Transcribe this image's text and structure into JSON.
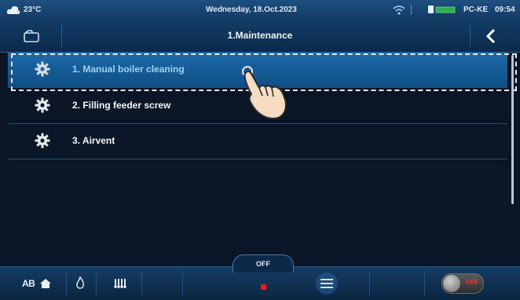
{
  "status_bar": {
    "temperature": "23°C",
    "date": "Wednesday, 18.Oct.2023",
    "controller": "PC-KE",
    "time": "09:54"
  },
  "header": {
    "title": "1.Maintenance",
    "back_icon": "chevron-left-icon",
    "left_icon": "folder-icon"
  },
  "menu": {
    "items": [
      {
        "label": "1.  Manual boiler cleaning",
        "icon": "gear-icon",
        "selected": true
      },
      {
        "label": "2.  Filling feeder screw",
        "icon": "gear-icon",
        "selected": false
      },
      {
        "label": "3.  Airvent",
        "icon": "gear-icon",
        "selected": false
      }
    ]
  },
  "bottom_bar": {
    "mode_label": "AB",
    "state_tab": "OFF",
    "toggle_label": "OFF"
  },
  "colors": {
    "background": "#0a1626",
    "selected_row": "#1c6aa8",
    "accent_red": "#e23a3a"
  }
}
